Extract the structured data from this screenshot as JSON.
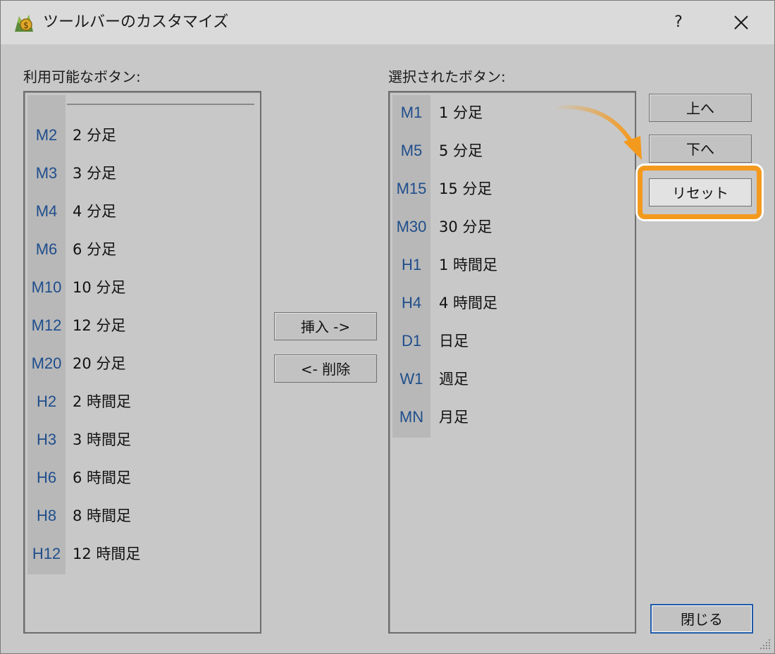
{
  "window": {
    "title": "ツールバーのカスタマイズ",
    "help_label": "?",
    "icon": "metatrader-app-icon"
  },
  "available": {
    "label": "利用可能なボタン:",
    "items": [
      {
        "code": "M2",
        "label": "2 分足"
      },
      {
        "code": "M3",
        "label": "3 分足"
      },
      {
        "code": "M4",
        "label": "4 分足"
      },
      {
        "code": "M6",
        "label": "6 分足"
      },
      {
        "code": "M10",
        "label": "10 分足"
      },
      {
        "code": "M12",
        "label": "12 分足"
      },
      {
        "code": "M20",
        "label": "20 分足"
      },
      {
        "code": "H2",
        "label": "2 時間足"
      },
      {
        "code": "H3",
        "label": "3 時間足"
      },
      {
        "code": "H6",
        "label": "6 時間足"
      },
      {
        "code": "H8",
        "label": "8 時間足"
      },
      {
        "code": "H12",
        "label": "12 時間足"
      }
    ]
  },
  "selected": {
    "label": "選択されたボタン:",
    "items": [
      {
        "code": "M1",
        "label": "1 分足"
      },
      {
        "code": "M5",
        "label": "5 分足"
      },
      {
        "code": "M15",
        "label": "15 分足"
      },
      {
        "code": "M30",
        "label": "30 分足"
      },
      {
        "code": "H1",
        "label": "1 時間足"
      },
      {
        "code": "H4",
        "label": "4 時間足"
      },
      {
        "code": "D1",
        "label": "日足"
      },
      {
        "code": "W1",
        "label": "週足"
      },
      {
        "code": "MN",
        "label": "月足"
      }
    ]
  },
  "buttons": {
    "insert": "挿入 ->",
    "remove": "<- 削除",
    "up": "上へ",
    "down": "下へ",
    "reset": "リセット",
    "close": "閉じる"
  },
  "colors": {
    "accent_highlight": "#f39a1e",
    "code_text": "#1f4e8c",
    "window_bg": "#c8c8c8",
    "default_button_border": "#1e5aa8"
  }
}
